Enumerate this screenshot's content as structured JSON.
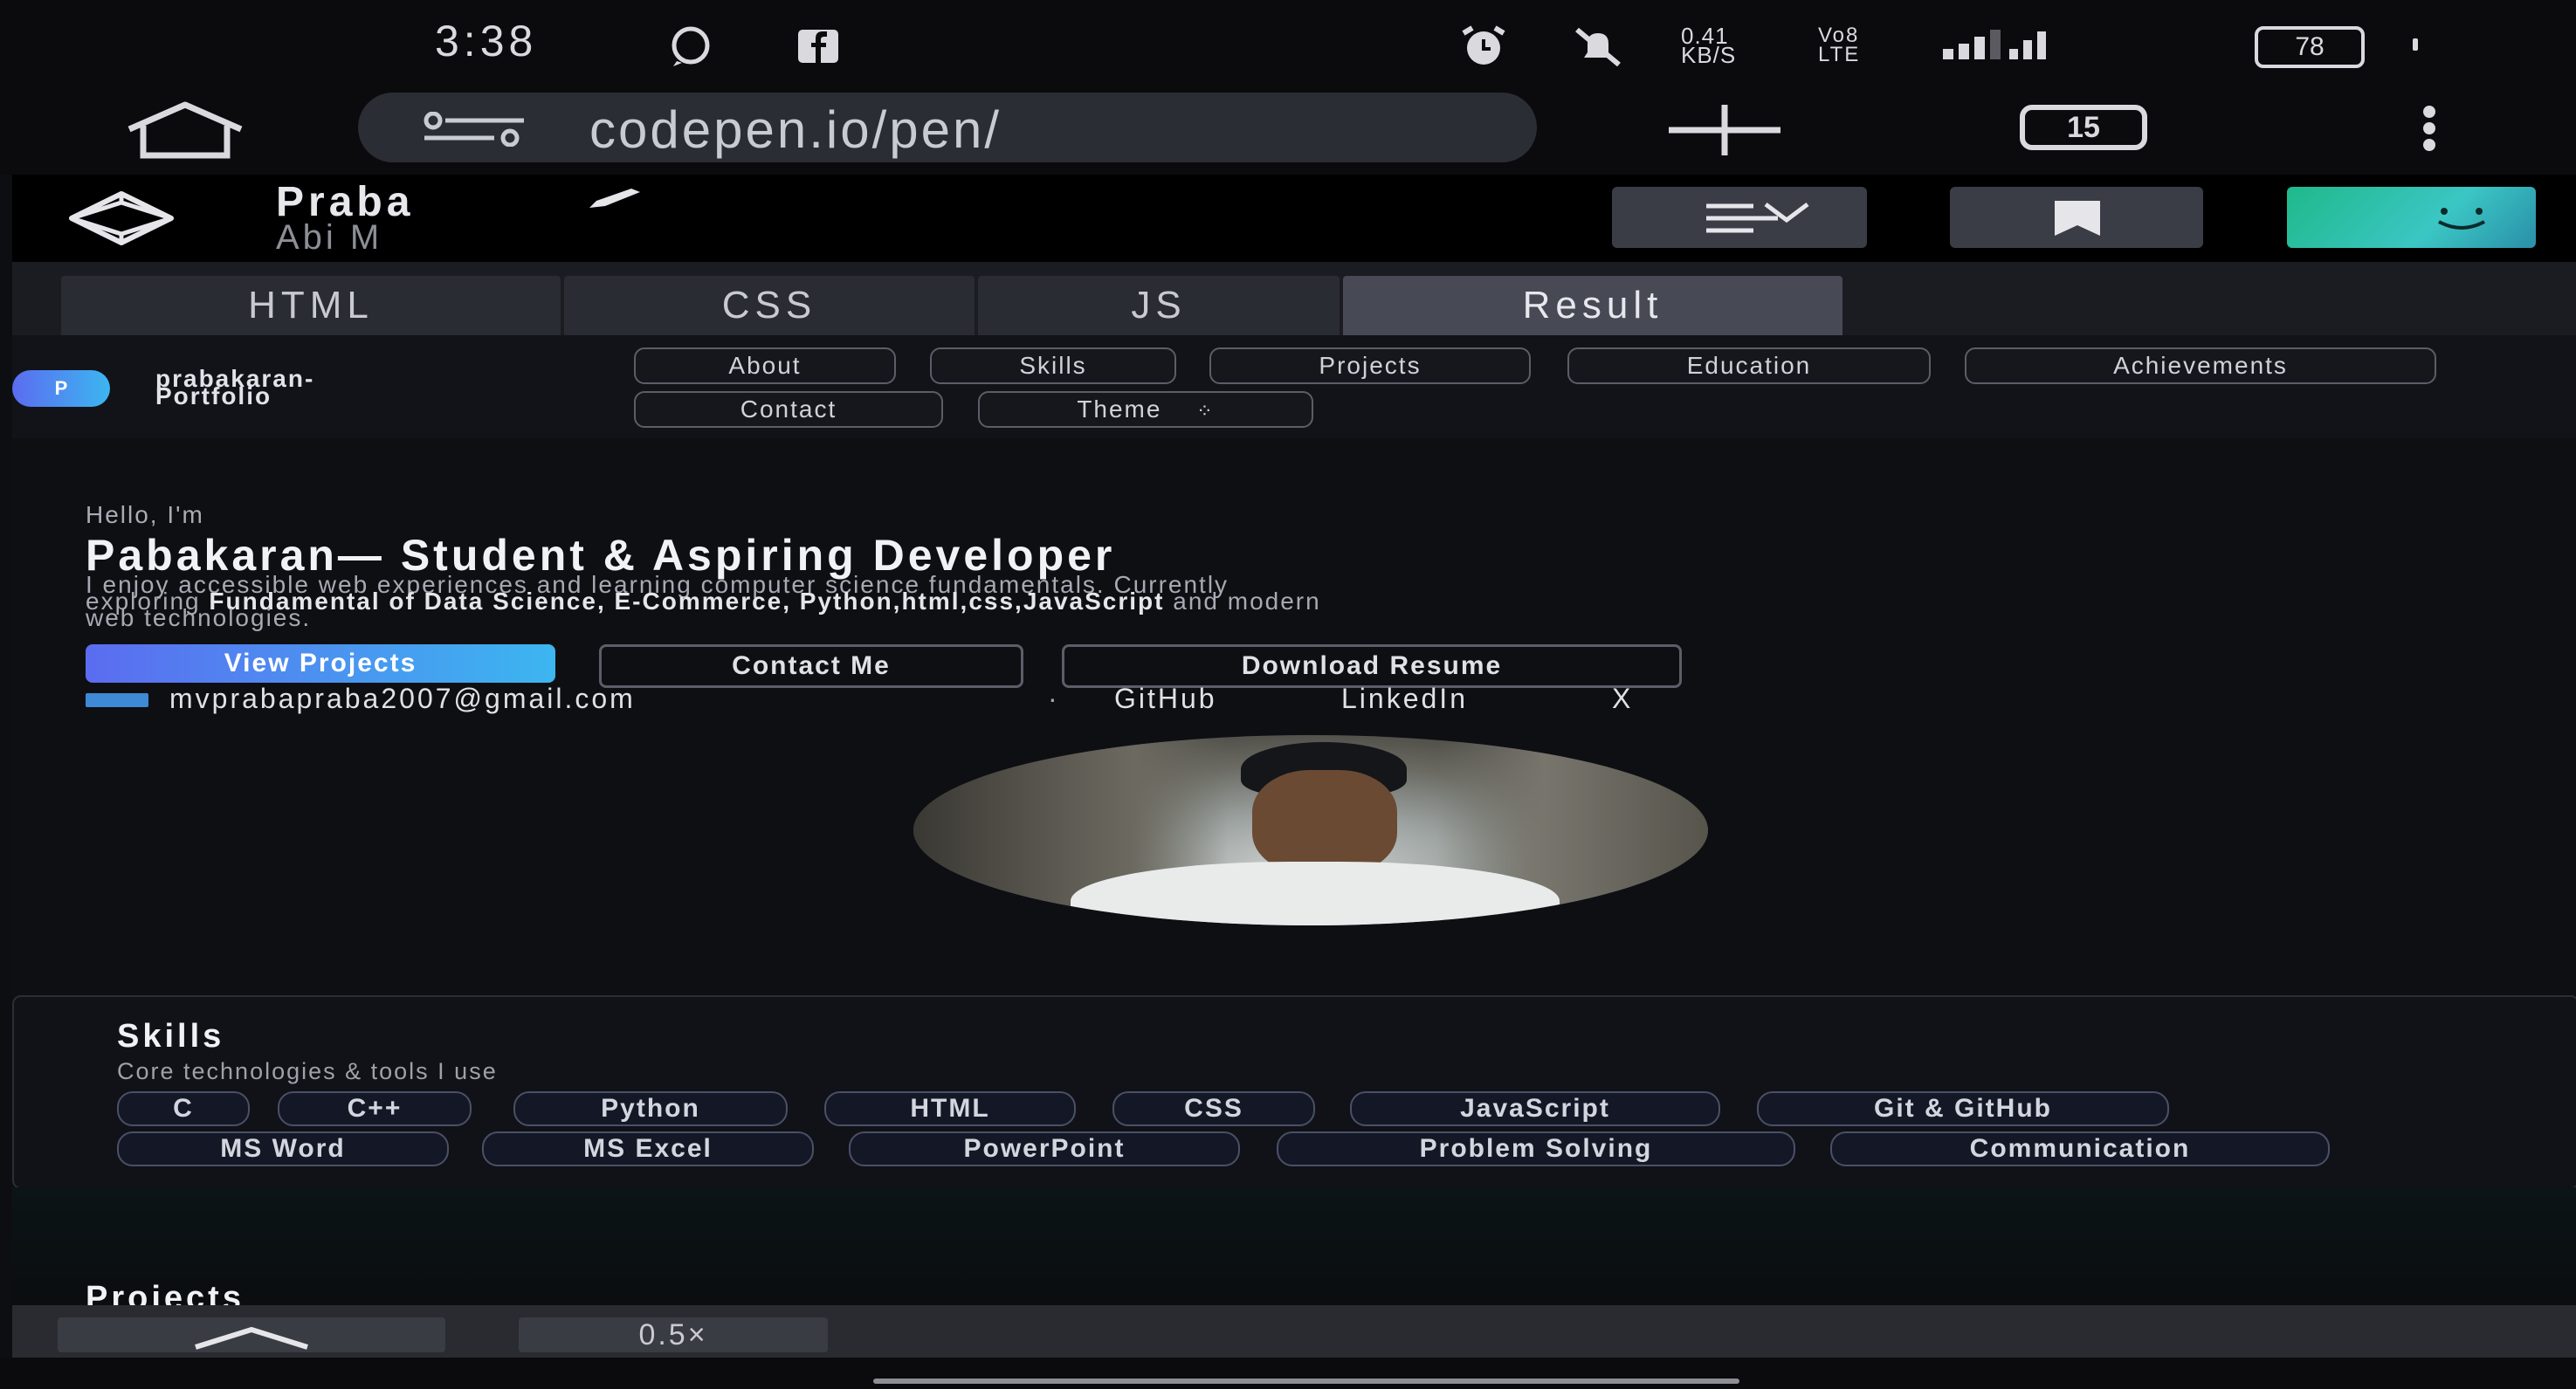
{
  "status_bar": {
    "time": "3:38",
    "network_speed": "0.41 KB/S",
    "battery": "78",
    "icons": [
      "whatsapp-icon",
      "facebook-icon",
      "alarm-icon",
      "mute-icon",
      "signal-icon",
      "signal-4g-icon",
      "battery-icon"
    ]
  },
  "browser": {
    "url": "codepen.io/pen/",
    "tab_count": "15",
    "icons": [
      "home-icon",
      "site-settings-icon",
      "new-tab-icon",
      "tabs-icon",
      "menu-icon"
    ]
  },
  "codepen": {
    "pen_title": "Praba",
    "author": "Abi M",
    "tabs": [
      "HTML",
      "CSS",
      "JS",
      "Result"
    ],
    "active_tab": "Result",
    "zoom": "0.5×"
  },
  "site": {
    "brand_initial": "P",
    "brand_name_line1": "prabakaran-",
    "brand_name_line2": "Portfolio",
    "nav": [
      "About",
      "Skills",
      "Projects",
      "Education",
      "Achievements",
      "Contact",
      "Theme"
    ],
    "greeting": "Hello, I'm",
    "headline": "Pabakaran— Student & Aspiring Developer",
    "intro_line1": "I enjoy accessible web experiences and learning computer science fundamentals. Currently",
    "intro_line2_pre": "exploring ",
    "intro_line2_bold": "Fundamental of Data Science, E-Commerce, Python,html,css,JavaScript",
    "intro_line2_post": " and modern",
    "intro_line3": "web technologies.",
    "buttons": {
      "view_projects": "View Projects",
      "contact_me": "Contact Me",
      "download_resume": "Download Resume"
    },
    "email": "mvprabapraba2007@gmail.com",
    "separator": "·",
    "links": [
      "GitHub",
      "LinkedIn",
      "X"
    ],
    "skills_title": "Skills",
    "skills_subtitle": "Core technologies & tools I use",
    "skills": [
      "C",
      "C++",
      "Python",
      "HTML",
      "CSS",
      "JavaScript",
      "Git & GitHub",
      "MS Word",
      "MS Excel",
      "PowerPoint",
      "Problem Solving",
      "Communication"
    ],
    "projects_title": "Projects"
  },
  "colors": {
    "accent_gradient_start": "#5b6cf0",
    "accent_gradient_end": "#3cb6f0",
    "avatar_gradient": "#1fb98a",
    "background": "#0d0e12"
  }
}
